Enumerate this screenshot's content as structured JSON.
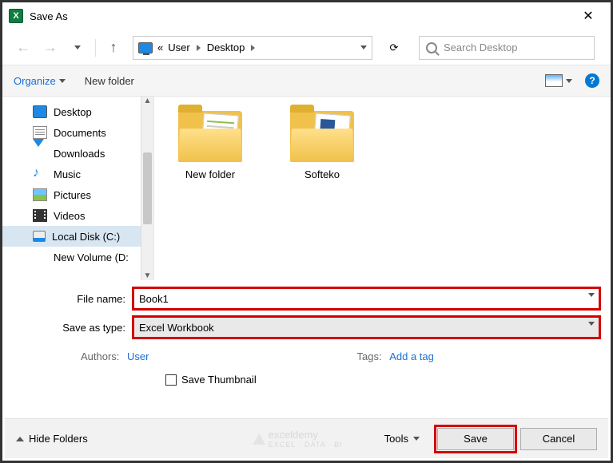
{
  "title": "Save As",
  "breadcrumb": {
    "prefix": "«",
    "user": "User",
    "loc": "Desktop"
  },
  "search": {
    "placeholder": "Search Desktop"
  },
  "toolbar": {
    "organize": "Organize",
    "newfolder": "New folder"
  },
  "tree": {
    "desktop": "Desktop",
    "documents": "Documents",
    "downloads": "Downloads",
    "music": "Music",
    "pictures": "Pictures",
    "videos": "Videos",
    "localdisk": "Local Disk (C:)",
    "truncated": "New Volume (D:"
  },
  "folders": {
    "f1": "New folder",
    "f2": "Softeko"
  },
  "form": {
    "filename_label": "File name:",
    "filename_value": "Book1",
    "type_label": "Save as type:",
    "type_value": "Excel Workbook",
    "authors_label": "Authors:",
    "authors_value": "User",
    "tags_label": "Tags:",
    "tags_value": "Add a tag",
    "thumb": "Save Thumbnail"
  },
  "footer": {
    "hide": "Hide Folders",
    "tools": "Tools",
    "save": "Save",
    "cancel": "Cancel"
  },
  "watermark": {
    "brand": "exceldemy",
    "sub": "EXCEL · DATA · BI"
  }
}
